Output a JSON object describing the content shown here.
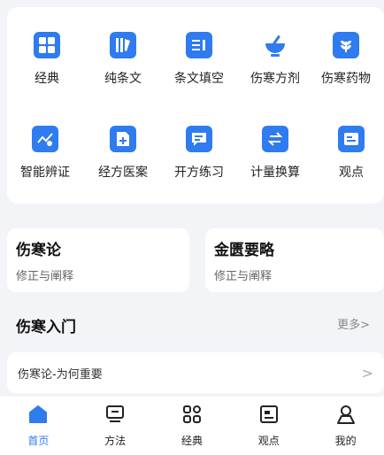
{
  "colors": {
    "accent": "#2f7bf0",
    "background": "#f3f4f8"
  },
  "grid": {
    "row1": [
      {
        "label": "经典",
        "icon": "grid-icon"
      },
      {
        "label": "纯条文",
        "icon": "book-pen-icon"
      },
      {
        "label": "条文填空",
        "icon": "fill-blank-icon"
      },
      {
        "label": "伤寒方剂",
        "icon": "mortar-icon"
      },
      {
        "label": "伤寒药物",
        "icon": "herb-icon"
      }
    ],
    "row2": [
      {
        "label": "智能辨证",
        "icon": "ai-chart-icon"
      },
      {
        "label": "经方医案",
        "icon": "medical-doc-icon"
      },
      {
        "label": "开方练习",
        "icon": "chat-icon"
      },
      {
        "label": "计量换算",
        "icon": "swap-icon"
      },
      {
        "label": "观点",
        "icon": "id-card-icon"
      }
    ]
  },
  "books": [
    {
      "title": "伤寒论",
      "subtitle": "修正与阐释"
    },
    {
      "title": "金匮要略",
      "subtitle": "修正与阐释"
    }
  ],
  "intro": {
    "title": "伤寒入门",
    "more": "更多>",
    "items": [
      {
        "text": "伤寒论-为何重要",
        "chevron": ">"
      }
    ]
  },
  "tabbar": [
    {
      "label": "首页",
      "icon": "home-icon",
      "active": true
    },
    {
      "label": "方法",
      "icon": "monitor-icon",
      "active": false
    },
    {
      "label": "经典",
      "icon": "apps-icon",
      "active": false
    },
    {
      "label": "观点",
      "icon": "id-card-icon",
      "active": false
    },
    {
      "label": "我的",
      "icon": "user-icon",
      "active": false
    }
  ]
}
